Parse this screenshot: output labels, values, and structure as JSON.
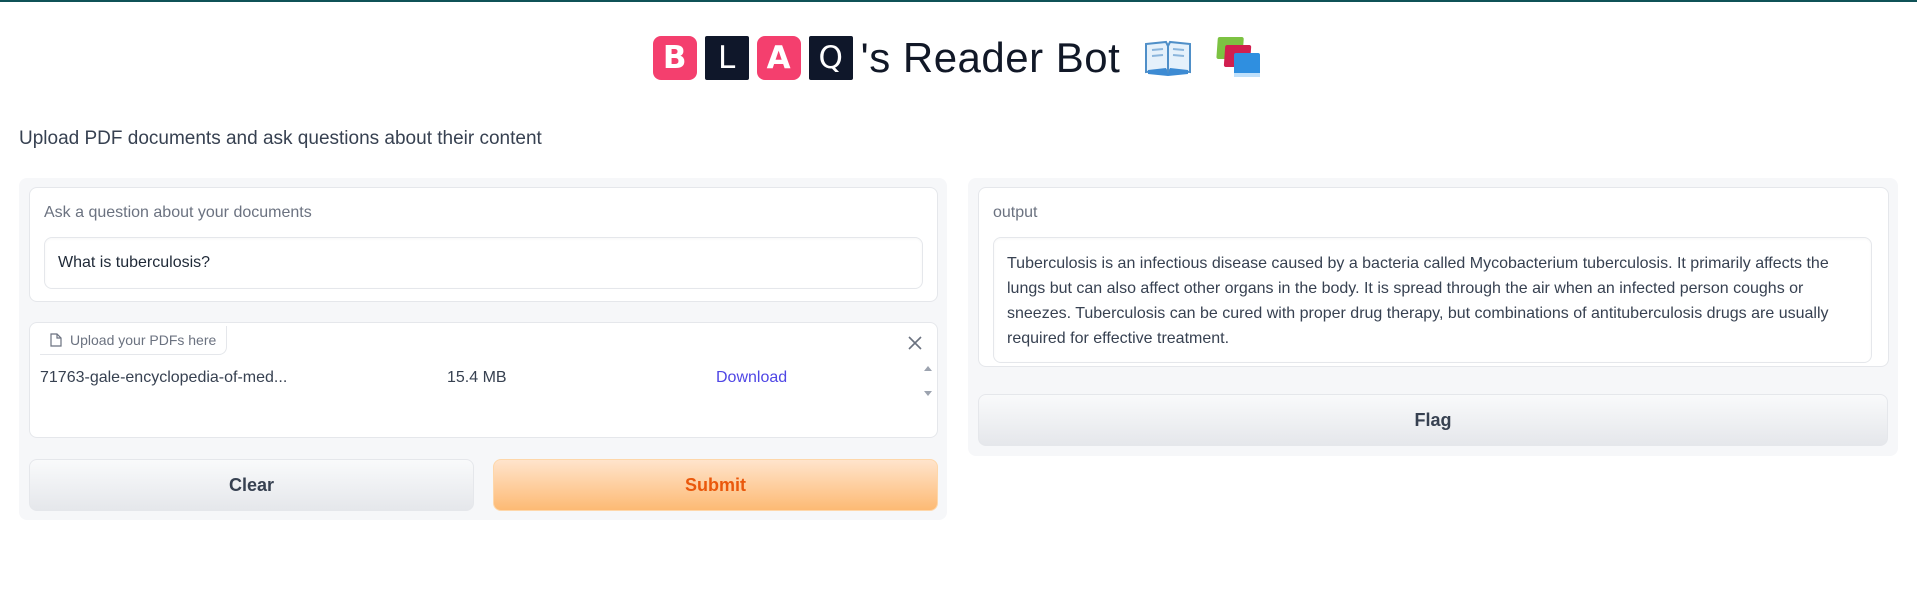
{
  "header": {
    "title_letters": [
      "B",
      "L",
      "A",
      "Q"
    ],
    "title_suffix": "'s Reader Bot",
    "emoji_icons": [
      "open-book-icon",
      "books-icon"
    ]
  },
  "description": "Upload PDF documents and ask questions about their content",
  "input_panel": {
    "question_label": "Ask a question about your documents",
    "question_value": "What is tuberculosis?",
    "upload_label": "Upload your PDFs here",
    "file": {
      "name": "71763-gale-encyclopedia-of-med...",
      "size": "15.4 MB",
      "download_label": "Download"
    },
    "clear_label": "Clear",
    "submit_label": "Submit"
  },
  "output_panel": {
    "label": "output",
    "text": "Tuberculosis is an infectious disease caused by a bacteria called Mycobacterium tuberculosis. It primarily affects the lungs but can also affect other organs in the body. It is spread through the air when an infected person coughs or sneezes. Tuberculosis can be cured with proper drug therapy, but combinations of antituberculosis drugs are usually required for effective treatment.",
    "flag_label": "Flag"
  },
  "colors": {
    "accent_red": "#f43f6e",
    "accent_dark": "#0f172a",
    "primary_button": "#fdba74",
    "link": "#4f46e5"
  }
}
